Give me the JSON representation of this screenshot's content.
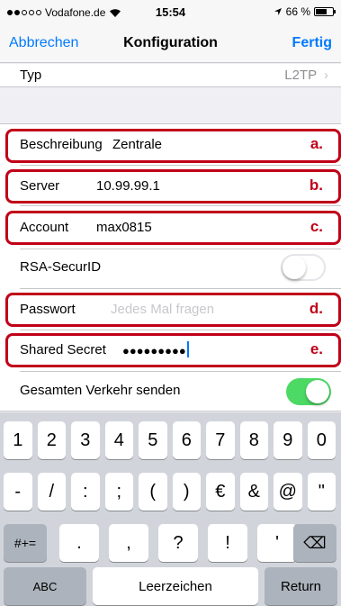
{
  "status_bar": {
    "carrier": "Vodafone.de",
    "time": "15:54",
    "battery_percent": "66 %",
    "signal_bars_filled": 2,
    "signal_bars_total": 5,
    "battery_level": 0.66
  },
  "nav": {
    "cancel_label": "Abbrechen",
    "title": "Konfiguration",
    "done_label": "Fertig"
  },
  "typ_row": {
    "label": "Typ",
    "value": "L2TP"
  },
  "fields": {
    "beschreibung": {
      "label": "Beschreibung",
      "value": "Zentrale",
      "marker": "a."
    },
    "server": {
      "label": "Server",
      "value": "10.99.99.1",
      "marker": "b."
    },
    "account": {
      "label": "Account",
      "value": "max0815",
      "marker": "c."
    },
    "rsa": {
      "label": "RSA-SecurID",
      "toggle_on": false
    },
    "passwort": {
      "label": "Passwort",
      "placeholder": "Jedes Mal fragen",
      "marker": "d."
    },
    "shared_secret": {
      "label": "Shared Secret",
      "value": "●●●●●●●●●",
      "marker": "e."
    },
    "gesamten": {
      "label": "Gesamten Verkehr senden",
      "toggle_on": true
    }
  },
  "colors": {
    "accent": "#007aff",
    "highlight": "#c00018",
    "toggle_on": "#4cd964"
  },
  "keyboard": {
    "row1": [
      "1",
      "2",
      "3",
      "4",
      "5",
      "6",
      "7",
      "8",
      "9",
      "0"
    ],
    "row2": [
      "-",
      "/",
      ":",
      ";",
      "(",
      ")",
      "€",
      "&",
      "@",
      "\""
    ],
    "row3_left": "#+=",
    "row3": [
      ".",
      ",",
      "?",
      "!",
      "'"
    ],
    "backspace_icon": "⌫",
    "abc_label": "ABC",
    "space_label": "Leerzeichen",
    "return_label": "Return"
  }
}
